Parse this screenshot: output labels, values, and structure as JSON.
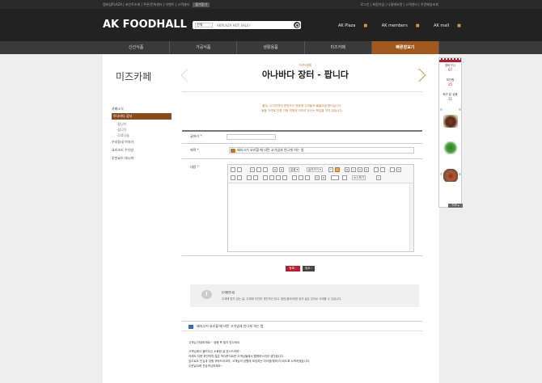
{
  "topbar": {
    "left_links": "멤버십PLAZA | 포인트조회 | 쿠폰/문화센터 | 이벤트 | 고객센터",
    "left_button": "즐겨찾기",
    "right_links": "로그인 | 회원가입 | 나중에보관 | 고객센터 | 주문배송조회"
  },
  "header": {
    "logo": "AK FOODHALL",
    "search_select": "전체",
    "search_query": "AKPLAZA HOT SALE!",
    "links": [
      "AK Plaza",
      "AK members",
      "AK mall"
    ]
  },
  "catnav": {
    "items": [
      "신선식품",
      "가공식품",
      "생활용품",
      "미즈카페",
      "빠른장보기"
    ],
    "active_index": 4
  },
  "sidebar": {
    "title": "미즈카페",
    "menu": [
      {
        "label": "카페소식",
        "active": false
      },
      {
        "label": "아나바다 장터",
        "active": true
      }
    ],
    "submenu": [
      "·팝니다",
      "·삽니다",
      "·무료나눔"
    ],
    "menu_after": [
      "우리동네 이야기",
      "요리조리 수다방",
      "추천요리 레시피"
    ]
  },
  "page": {
    "breadcrumb": "미즈카페",
    "title": "아나바다 장터 - 팝니다",
    "notice_line1": "물당, 수지지역의 환영하고 평등한 주부들의 물물교환 합터입니다.",
    "notice_line2": "물물 거래로 인한 각종 피해에 대하여 당사는 책임을 지지 않습니다."
  },
  "form": {
    "header_label": "글머리",
    "subject_label": "제목",
    "subject_value": "돼지고기 요리할 때 비린 고기냄새 안나게 하는 법",
    "content_label": "내용",
    "required_mark": "*"
  },
  "editor_toolbar": {
    "font_select": "글꼴 ▾",
    "size_select": "글자크기 ▾",
    "html_button": "소스보기"
  },
  "buttons": {
    "ok": "등록 ›",
    "cancel": "취소 ›"
  },
  "guide": {
    "icon": "!",
    "title": "[이용안내]",
    "desc": "주제에 맞지 않는 글, 주제에 무관한 개인적인 광고, 음란/홍보/비방 등의 글은 임의로 삭제할 수 있습니다."
  },
  "preview": {
    "title": "돼지고기 요리할 때 비린 고기냄새 안나게 하는 법",
    "lines": [
      "고객님 안녕하세요~ 새해 복 많이 받으세요",
      "",
      "고객님께서 올려주신 소중한 글 감사드리며~",
      "아래도 처음 조언하여 많은 먹다운지요큰 고객님들께서 활용하시리라 생각됩니다.",
      "앞으로도 관심과 성원 부탁드리오며, 고객님의 성원에 보답하는 아이엠(에프)이 되도록 노력하겠습니다.",
      "주운날씨에 건강조심하세요~"
    ]
  },
  "right_panel": {
    "cart_label": "장바구니",
    "cart_count": "07",
    "wish_label": "보관함",
    "wish_count": "25",
    "recent_label": "최근 본 상품",
    "recent_count": "11",
    "top_button": "TOP ▴"
  },
  "colors": {
    "brand_brown": "#8a4a1f",
    "accent_red": "#b22035",
    "gold": "#c8a050"
  }
}
